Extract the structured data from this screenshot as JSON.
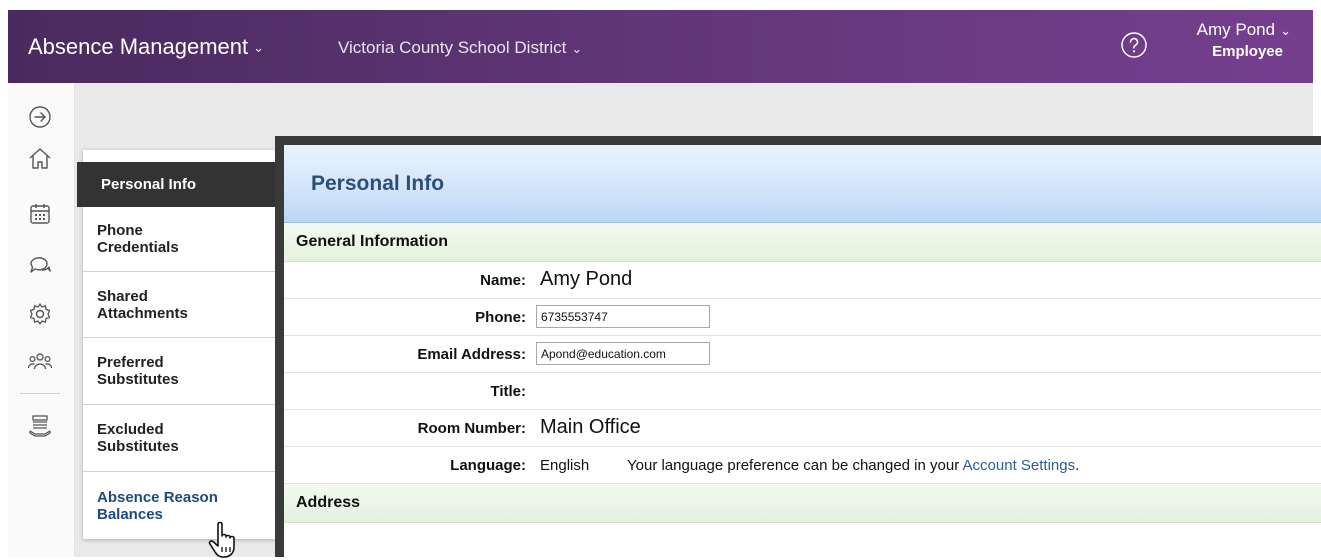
{
  "topbar": {
    "app_title": "Absence Management",
    "district": "Victoria County School District",
    "user_name": "Amy Pond",
    "user_role": "Employee",
    "chevron": "⌄"
  },
  "rail": {
    "icons": [
      "arrow-right-circle-icon",
      "home-icon",
      "calendar-icon",
      "chat-icon",
      "gear-icon",
      "people-icon",
      "stack-icon"
    ]
  },
  "tabs": {
    "personal_info": "Personal Info",
    "phone_credentials": [
      "Phone",
      "Credentials"
    ],
    "shared_attachments": [
      "Shared",
      "Attachments"
    ],
    "preferred_substitutes": [
      "Preferred",
      "Substitutes"
    ],
    "excluded_substitutes": [
      "Excluded",
      "Substitutes"
    ],
    "absence_reason_balances": [
      "Absence Reason",
      "Balances"
    ]
  },
  "panel": {
    "title": "Personal Info",
    "general_section": "General Information",
    "address_section": "Address",
    "fields": {
      "name_label": "Name:",
      "name_value": "Amy Pond",
      "phone_label": "Phone:",
      "phone_value": "6735553747",
      "email_label": "Email Address:",
      "email_value": "Apond@education.com",
      "title_label": "Title:",
      "room_label": "Room Number:",
      "room_value": "Main Office",
      "language_label": "Language:",
      "language_value": "English",
      "language_note": "Your language preference can be changed in your",
      "account_settings_link": "Account Settings",
      "period": "."
    }
  },
  "colors": {
    "topbar_start": "#4a2a5e",
    "topbar_end": "#753f8d",
    "active_tab": "#333333",
    "panel_title": "#2c4f7a",
    "link": "#2a5f94"
  }
}
